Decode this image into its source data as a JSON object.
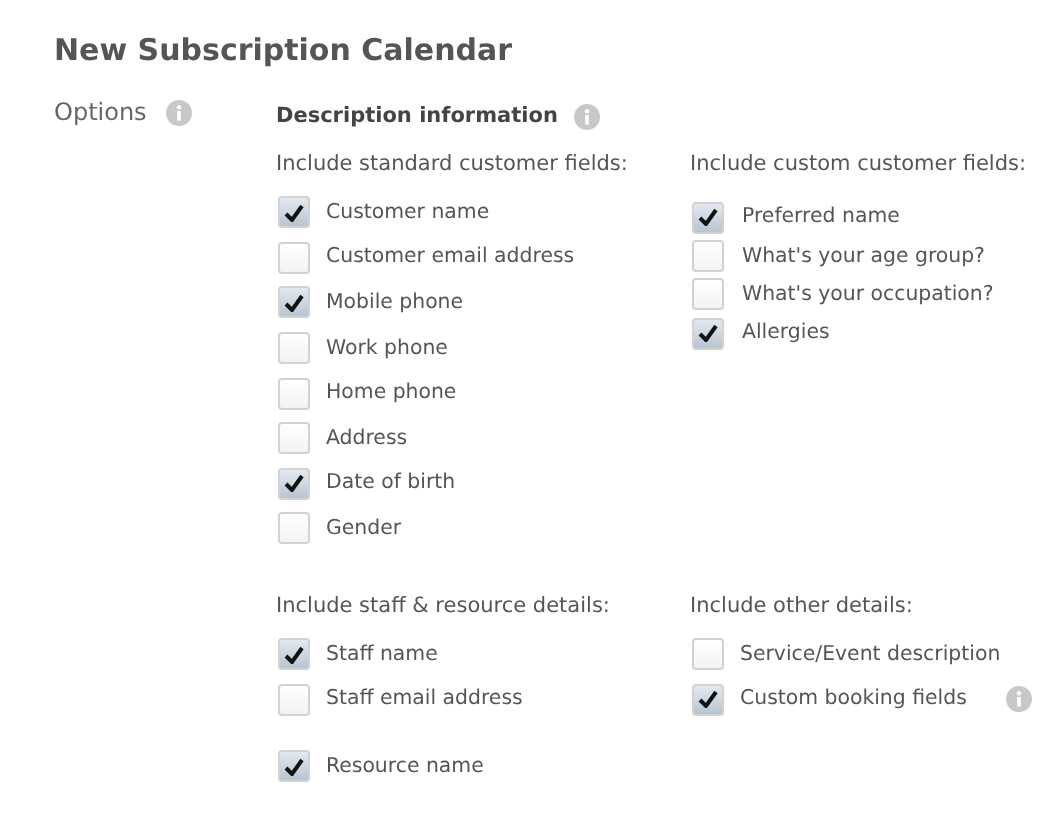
{
  "title": "New Subscription Calendar",
  "options_label": "Options",
  "section": {
    "title": "Description information",
    "groups": [
      {
        "heading": "Include standard customer fields:",
        "kind": "left",
        "items": [
          {
            "label": "Customer name",
            "checked": true
          },
          {
            "label": "Customer email address",
            "checked": false
          },
          {
            "label": "Mobile phone",
            "checked": true
          },
          {
            "label": "Work phone",
            "checked": false
          },
          {
            "label": "Home phone",
            "checked": false
          },
          {
            "label": "Address",
            "checked": false
          },
          {
            "label": "Date of birth",
            "checked": true
          },
          {
            "label": "Gender",
            "checked": false
          }
        ]
      },
      {
        "heading": "Include custom customer fields:",
        "kind": "right",
        "items": [
          {
            "label": "Preferred name",
            "checked": true
          },
          {
            "label": "What's your age group?",
            "checked": false
          },
          {
            "label": "What's your occupation?",
            "checked": false
          },
          {
            "label": "Allergies",
            "checked": true
          }
        ]
      },
      {
        "heading": "Include staff & resource details:",
        "kind": "left",
        "items": [
          {
            "label": "Staff name",
            "checked": true
          },
          {
            "label": "Staff email address",
            "checked": false
          },
          {
            "label": "Resource name",
            "checked": true,
            "separated": true
          }
        ]
      },
      {
        "heading": "Include other details:",
        "kind": "right",
        "items": [
          {
            "label": "Service/Event description",
            "checked": false
          },
          {
            "label": "Custom booking fields",
            "checked": true,
            "info": true
          }
        ]
      }
    ]
  }
}
